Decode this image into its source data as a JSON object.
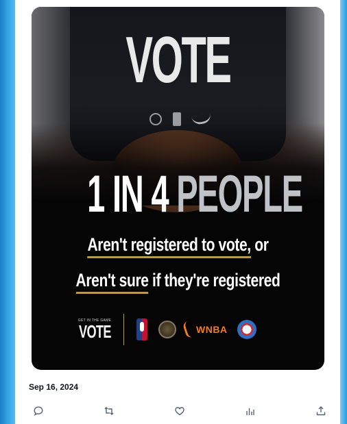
{
  "post": {
    "date": "Sep 16, 2024"
  },
  "image": {
    "shirt_text": "VOTE",
    "headline_part1": "1 IN 4 ",
    "headline_part2": "PEOPLE",
    "line1_underlined": "Aren't registered to vote,",
    "line1_rest": " or",
    "line2_underlined": "Aren't sure",
    "line2_rest": " if they're registered",
    "campaign_small": "GET IN THE GAME",
    "campaign_big": "VOTE",
    "partner_wnba": "WNBA",
    "accent_gold": "#b99a4a",
    "wnba_orange": "#f57b20"
  },
  "actions": [
    {
      "name": "reply",
      "icon": "speech-bubble-icon"
    },
    {
      "name": "repost",
      "icon": "repost-arrows-icon"
    },
    {
      "name": "like",
      "icon": "heart-icon"
    },
    {
      "name": "views",
      "icon": "bar-chart-icon"
    },
    {
      "name": "share",
      "icon": "upload-arrow-icon"
    }
  ]
}
